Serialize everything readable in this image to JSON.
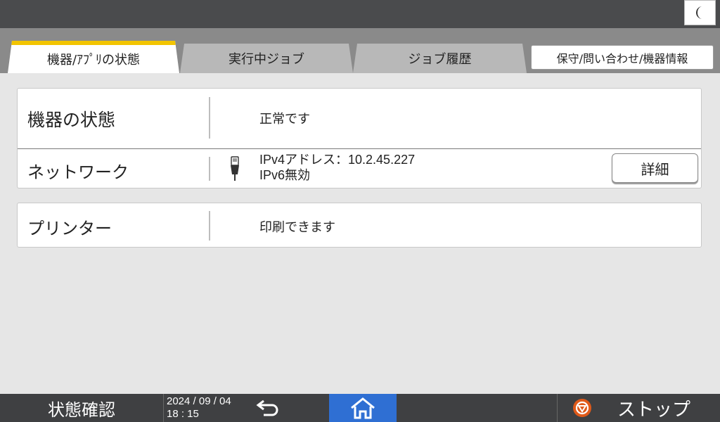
{
  "tabs": [
    {
      "label": "機器/ｱﾌﾟﾘの状態",
      "state": "active"
    },
    {
      "label": "実行中ジョブ",
      "state": "inactive"
    },
    {
      "label": "ジョブ履歴",
      "state": "inactive"
    },
    {
      "label": "保守/問い合わせ/機器情報",
      "state": "button"
    }
  ],
  "device_status": {
    "label": "機器の状態",
    "value": "正常です"
  },
  "network": {
    "label": "ネットワーク",
    "ipv4_line": "IPv4アドレス：10.2.45.227",
    "ipv6_line": "IPv6無効",
    "detail_button": "詳細",
    "icon": "lan-cable-icon"
  },
  "printer": {
    "label": "プリンター",
    "value": "印刷できます"
  },
  "bottom_bar": {
    "title": "状態確認",
    "date": "2024 / 09 / 04",
    "time": "18 : 15",
    "back_icon": "back-arrow-icon",
    "home_icon": "home-icon",
    "stop_label": "ストップ",
    "stop_icon": "stop-icon"
  },
  "top_bar": {
    "sleep_icon": "moon-icon"
  },
  "colors": {
    "accent_tab": "#f2c400",
    "home_button": "#2f6fd3",
    "stop_icon": "#e05a1a",
    "bar": "#3f4042"
  }
}
